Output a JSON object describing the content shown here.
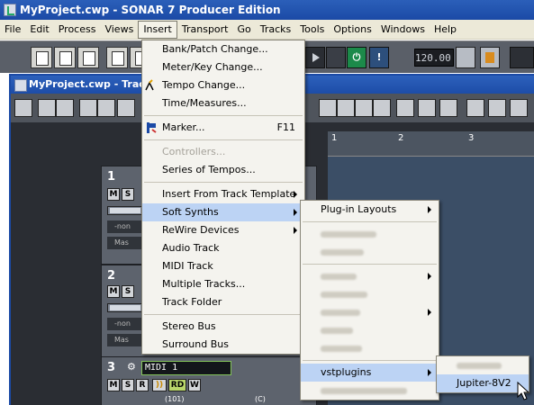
{
  "window": {
    "title": "MyProject.cwp - SONAR 7 Producer Edition"
  },
  "menubar": {
    "items": [
      "File",
      "Edit",
      "Process",
      "Views",
      "Insert",
      "Transport",
      "Go",
      "Tracks",
      "Tools",
      "Options",
      "Windows",
      "Help"
    ],
    "active": "Insert"
  },
  "toolbar": {
    "tempo": "120.00"
  },
  "track_view": {
    "title": "MyProject.cwp - Track",
    "ruler": [
      "1",
      "2",
      "3"
    ],
    "tracks": [
      {
        "number": "1",
        "buttons": [
          "M",
          "S"
        ],
        "sub_a": "-non",
        "sub_b": "Mas"
      },
      {
        "number": "2",
        "buttons": [
          "M",
          "S"
        ],
        "sub_a": "-non",
        "sub_b": "Mas"
      },
      {
        "number": "3",
        "name": "MIDI 1",
        "buttons": [
          "M",
          "S",
          "R",
          "RD",
          "W"
        ],
        "volume": "(101)",
        "pan": "(C)"
      }
    ]
  },
  "insert_menu": {
    "groups": [
      [
        {
          "label": "Bank/Patch Change..."
        },
        {
          "label": "Meter/Key Change..."
        },
        {
          "label": "Tempo Change..."
        },
        {
          "label": "Time/Measures..."
        }
      ],
      [
        {
          "label": "Marker...",
          "accel": "F11"
        }
      ],
      [
        {
          "label": "Controllers...",
          "disabled": true
        },
        {
          "label": "Series of Tempos..."
        }
      ],
      [
        {
          "label": "Insert From Track Template",
          "submenu": true
        },
        {
          "label": "Soft Synths",
          "submenu": true,
          "selected": true
        },
        {
          "label": "ReWire Devices",
          "submenu": true
        },
        {
          "label": "Audio Track"
        },
        {
          "label": "MIDI Track"
        },
        {
          "label": "Multiple Tracks..."
        },
        {
          "label": "Track Folder"
        }
      ],
      [
        {
          "label": "Stereo Bus"
        },
        {
          "label": "Surround Bus"
        }
      ]
    ]
  },
  "soft_synths_menu": {
    "top_item": "Plug-in Layouts",
    "selected_item": "vstplugins"
  },
  "vstplugins_menu": {
    "selected_item": "Jupiter-8V2"
  },
  "colors": {
    "menu_highlight": "#bcd3f4",
    "title_blue": "#1b4aa6",
    "menu_bg": "#f4f3ee"
  }
}
